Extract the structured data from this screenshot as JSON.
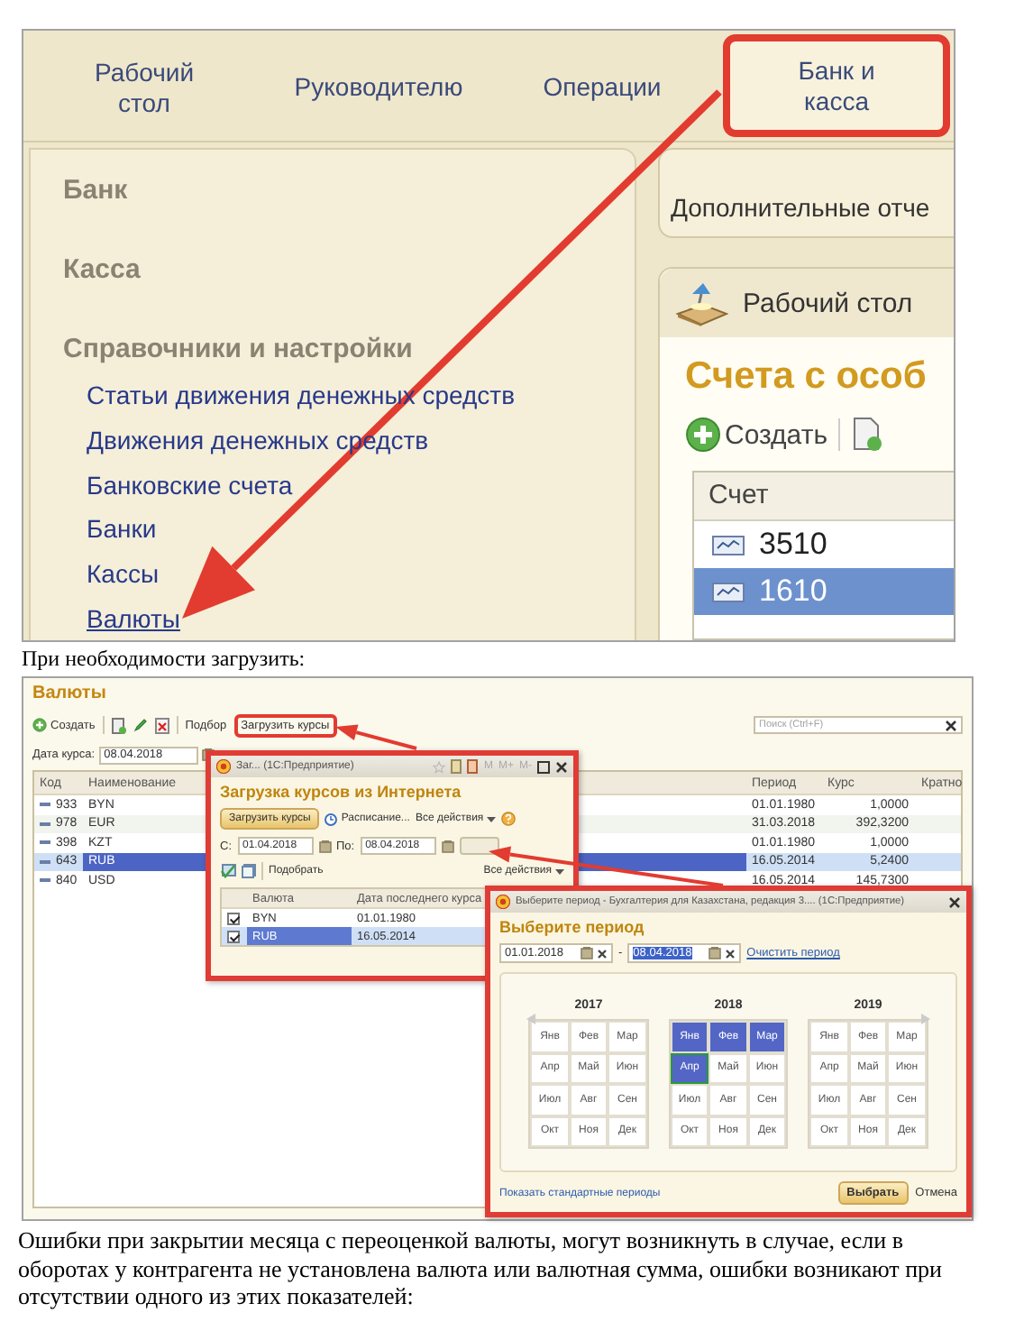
{
  "screenshot_1": {
    "nav_tabs": [
      {
        "label_lines": [
          "Рабочий",
          "стол"
        ],
        "selected": false,
        "annotated": false
      },
      {
        "label_lines": [
          "Руководителю"
        ],
        "selected": false,
        "annotated": false
      },
      {
        "label_lines": [
          "Операции"
        ],
        "selected": false,
        "annotated": false
      },
      {
        "label_lines": [
          "Банк и",
          "касса"
        ],
        "selected": true,
        "annotated": true
      }
    ],
    "sections": [
      {
        "title": "Банк"
      },
      {
        "title": "Касса"
      },
      {
        "title": "Справочники и настройки",
        "links": [
          {
            "label": "Статьи движения денежных средств",
            "hover": false
          },
          {
            "label": "Движения денежных средств",
            "hover": false
          },
          {
            "label": "Банковские счета",
            "hover": false
          },
          {
            "label": "Банки",
            "hover": false
          },
          {
            "label": "Кассы",
            "hover": false
          },
          {
            "label": "Валюты",
            "hover": true
          }
        ]
      }
    ],
    "reports_label": "Дополнительные отче",
    "desktop_tab": "Рабочий стол",
    "list_title": "Счета с особ",
    "create_button": "Создать",
    "table": {
      "columns": [
        "Счет"
      ],
      "rows": [
        {
          "cells": [
            "3510"
          ],
          "selected": false
        },
        {
          "cells": [
            "1610"
          ],
          "selected": true
        }
      ]
    }
  },
  "caption": "При необходимости загрузить:",
  "screenshot_2": {
    "title": "Валюты",
    "toolbar": {
      "create": "Создать",
      "pick": "Подбор",
      "load": {
        "label": "Загрузить курсы",
        "annotated": true
      }
    },
    "search": {
      "placeholder": "Поиск (Ctrl+F)"
    },
    "rate_date": {
      "label": "Дата курса:",
      "value": "08.04.2018"
    },
    "table": {
      "columns": [
        "Код",
        "Наименование",
        "Период",
        "Курс",
        "Кратно"
      ],
      "rows": [
        {
          "code": "933",
          "name": "BYN",
          "period": "01.01.1980",
          "rate": "1,0000",
          "selected": false
        },
        {
          "code": "978",
          "name": "EUR",
          "period": "31.03.2018",
          "rate": "392,3200",
          "selected": false
        },
        {
          "code": "398",
          "name": "KZT",
          "period": "01.01.1980",
          "rate": "1,0000",
          "selected": false
        },
        {
          "code": "643",
          "name": "RUB",
          "period": "16.05.2014",
          "rate": "5,2400",
          "selected": true
        },
        {
          "code": "840",
          "name": "USD",
          "period": "16.05.2014",
          "rate": "145,7300",
          "selected": false
        }
      ]
    },
    "load_dialog": {
      "window_title": "Заг... (1С:Предприятие)",
      "memory_buttons": [
        "M",
        "M+",
        "M-"
      ],
      "heading": "Загрузка курсов из Интернета",
      "load_button": "Загрузить курсы",
      "schedule": "Расписание...",
      "actions": "Все действия",
      "from_label": "С:",
      "from_value": "01.04.2018",
      "to_label": "По:",
      "to_value": "08.04.2018",
      "pick": "Подобрать",
      "actions_2": "Все действия",
      "columns": [
        "Валюта",
        "Дата последнего курса"
      ],
      "rows": [
        {
          "currency": "BYN",
          "date": "01.01.1980",
          "checked": true,
          "selected": false
        },
        {
          "currency": "RUB",
          "date": "16.05.2014",
          "checked": true,
          "selected": true
        }
      ]
    },
    "period_dialog": {
      "window_title": "Выберите период - Бухгалтерия для Казахстана, редакция 3.... (1С:Предприятие)",
      "heading": "Выберите период",
      "from": {
        "value": "01.01.2018",
        "text_selected": false
      },
      "dash": "-",
      "to": {
        "value": "08.04.2018",
        "text_selected": true
      },
      "clear_link": "Очистить период",
      "years": [
        {
          "label": "2017",
          "months": [
            {
              "label": "Янв",
              "selected": false,
              "focused": false
            },
            {
              "label": "Фев",
              "selected": false,
              "focused": false
            },
            {
              "label": "Мар",
              "selected": false,
              "focused": false
            },
            {
              "label": "Апр",
              "selected": false,
              "focused": false
            },
            {
              "label": "Май",
              "selected": false,
              "focused": false
            },
            {
              "label": "Июн",
              "selected": false,
              "focused": false
            },
            {
              "label": "Июл",
              "selected": false,
              "focused": false
            },
            {
              "label": "Авг",
              "selected": false,
              "focused": false
            },
            {
              "label": "Сен",
              "selected": false,
              "focused": false
            },
            {
              "label": "Окт",
              "selected": false,
              "focused": false
            },
            {
              "label": "Ноя",
              "selected": false,
              "focused": false
            },
            {
              "label": "Дек",
              "selected": false,
              "focused": false
            }
          ]
        },
        {
          "label": "2018",
          "months": [
            {
              "label": "Янв",
              "selected": true,
              "focused": false
            },
            {
              "label": "Фев",
              "selected": true,
              "focused": false
            },
            {
              "label": "Мар",
              "selected": true,
              "focused": false
            },
            {
              "label": "Апр",
              "selected": true,
              "focused": true
            },
            {
              "label": "Май",
              "selected": false,
              "focused": false
            },
            {
              "label": "Июн",
              "selected": false,
              "focused": false
            },
            {
              "label": "Июл",
              "selected": false,
              "focused": false
            },
            {
              "label": "Авг",
              "selected": false,
              "focused": false
            },
            {
              "label": "Сен",
              "selected": false,
              "focused": false
            },
            {
              "label": "Окт",
              "selected": false,
              "focused": false
            },
            {
              "label": "Ноя",
              "selected": false,
              "focused": false
            },
            {
              "label": "Дек",
              "selected": false,
              "focused": false
            }
          ]
        },
        {
          "label": "2019",
          "months": [
            {
              "label": "Янв",
              "selected": false,
              "focused": false
            },
            {
              "label": "Фев",
              "selected": false,
              "focused": false
            },
            {
              "label": "Мар",
              "selected": false,
              "focused": false
            },
            {
              "label": "Апр",
              "selected": false,
              "focused": false
            },
            {
              "label": "Май",
              "selected": false,
              "focused": false
            },
            {
              "label": "Июн",
              "selected": false,
              "focused": false
            },
            {
              "label": "Июл",
              "selected": false,
              "focused": false
            },
            {
              "label": "Авг",
              "selected": false,
              "focused": false
            },
            {
              "label": "Сен",
              "selected": false,
              "focused": false
            },
            {
              "label": "Окт",
              "selected": false,
              "focused": false
            },
            {
              "label": "Ноя",
              "selected": false,
              "focused": false
            },
            {
              "label": "Дек",
              "selected": false,
              "focused": false
            }
          ]
        }
      ],
      "standard_periods_link": "Показать стандартные периоды",
      "ok_button": "Выбрать",
      "cancel_button": "Отмена"
    }
  },
  "paragraph": "Ошибки при закрытии месяца с переоценкой валюты, могут возникнуть в случае, если в оборотах у контрагента не установлена валюта или валютная сумма, ошибки возникают при отсутствии одного из этих показателей:"
}
